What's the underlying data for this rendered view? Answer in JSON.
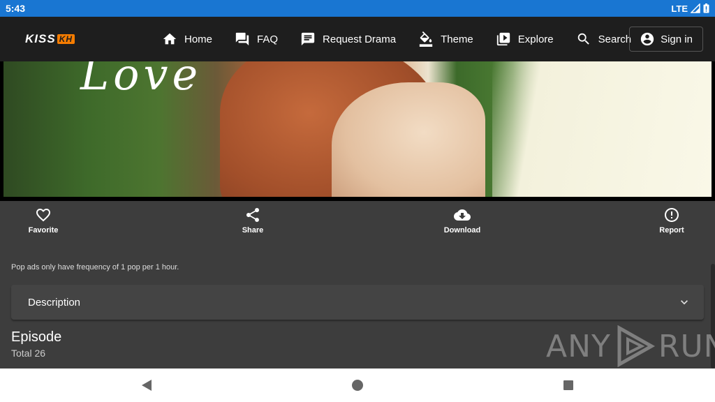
{
  "status_bar": {
    "time": "5:43",
    "network": "LTE"
  },
  "header": {
    "logo": {
      "part1": "KISS",
      "part2": "KH"
    },
    "nav": [
      {
        "label": "Home",
        "icon": "home-icon"
      },
      {
        "label": "FAQ",
        "icon": "forum-icon"
      },
      {
        "label": "Request Drama",
        "icon": "message-icon"
      },
      {
        "label": "Theme",
        "icon": "paint-bucket-icon"
      },
      {
        "label": "Explore",
        "icon": "video-library-icon"
      },
      {
        "label": "Search",
        "icon": "search-icon"
      }
    ],
    "sign_in": "Sign in"
  },
  "hero": {
    "overlay_text": "Love"
  },
  "actions": [
    {
      "label": "Favorite",
      "icon": "heart-icon"
    },
    {
      "label": "Share",
      "icon": "share-icon"
    },
    {
      "label": "Download",
      "icon": "cloud-download-icon"
    },
    {
      "label": "Report",
      "icon": "alert-circle-icon"
    }
  ],
  "note": "Pop ads only have frequency of 1 pop per 1 hour.",
  "description": {
    "label": "Description"
  },
  "episode": {
    "title": "Episode",
    "total": "Total 26"
  },
  "watermark": {
    "left": "ANY",
    "right": "RUN"
  },
  "colors": {
    "status_bar": "#1976d2",
    "app_bar": "#1e1e1e",
    "page_bg": "#3d3d3d",
    "logo_accent": "#f57c00"
  }
}
